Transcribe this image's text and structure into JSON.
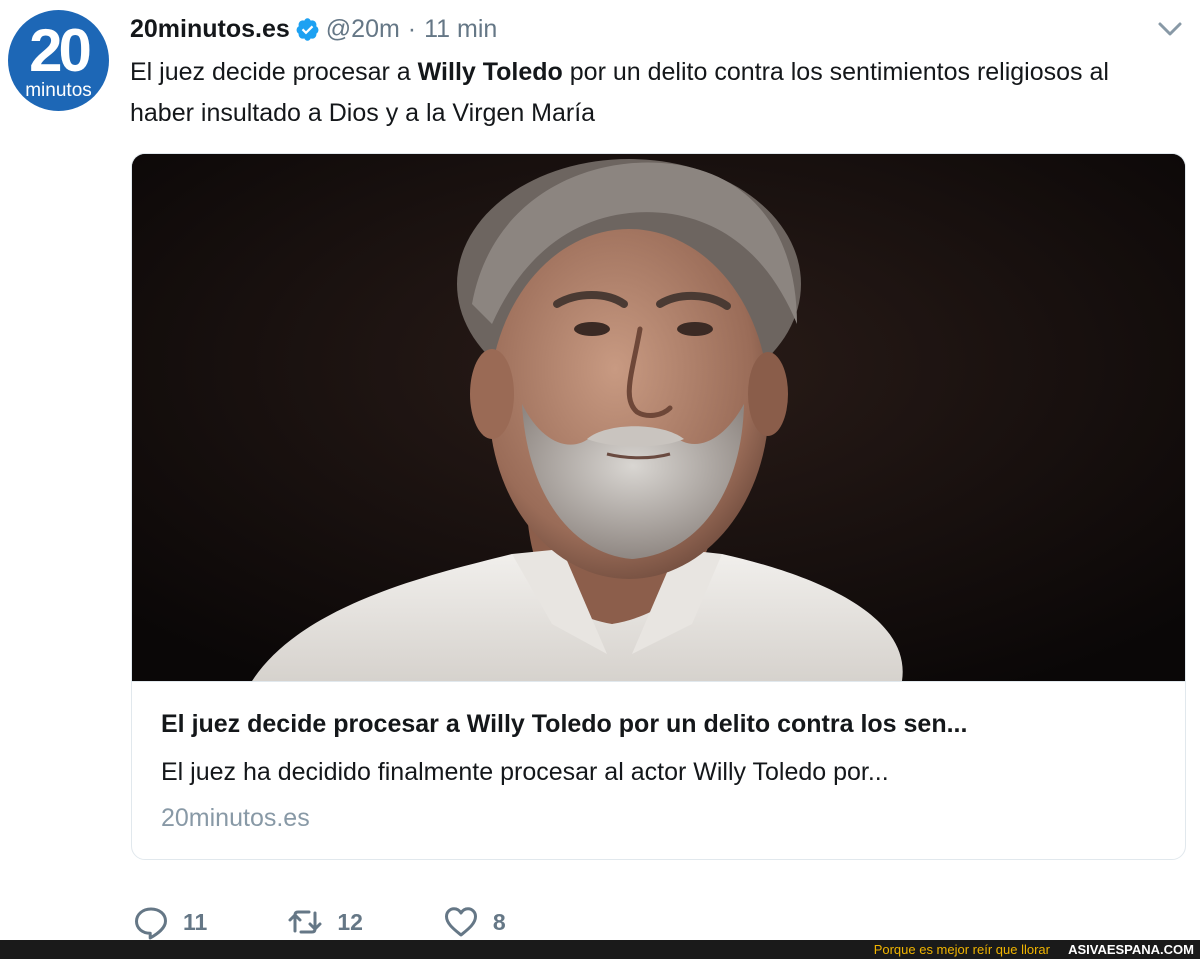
{
  "tweet": {
    "avatar": {
      "number": "20",
      "word": "minutos",
      "color": "#1d67b6"
    },
    "author_name": "20minutos.es",
    "handle": "@20m",
    "separator": "·",
    "time": "11 min",
    "text_before": "El juez decide procesar a ",
    "text_bold": "Willy Toledo",
    "text_after": " por un delito contra los sentimientos religiosos al haber insultado a Dios y a la Virgen María",
    "card": {
      "title": "El juez decide procesar a Willy Toledo por un delito contra los sen...",
      "description": "El juez ha decidido finalmente procesar al actor Willy Toledo por...",
      "domain": "20minutos.es"
    },
    "actions": {
      "replies": "11",
      "retweets": "12",
      "likes": "8"
    }
  },
  "footer": {
    "slogan": "Porque es mejor reír que llorar",
    "site": "ASIVAESPANA.COM"
  },
  "colors": {
    "verified": "#1da1f2",
    "muted": "#657786",
    "footer_slogan": "#f0b400"
  }
}
